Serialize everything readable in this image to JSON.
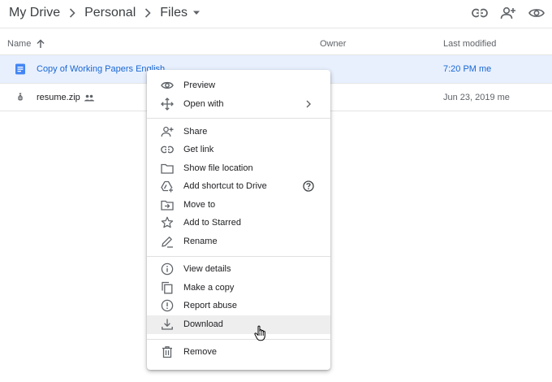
{
  "breadcrumb": {
    "items": [
      "My Drive",
      "Personal",
      "Files"
    ]
  },
  "header_icons": [
    "link-icon",
    "add-person-icon",
    "eye-icon"
  ],
  "columns": {
    "name": "Name",
    "owner": "Owner",
    "modified": "Last modified"
  },
  "files": [
    {
      "name": "Copy of Working Papers English",
      "owner": "",
      "modified": "7:20 PM",
      "by": "me",
      "icon": "google-doc-icon",
      "selected": true
    },
    {
      "name": "resume.zip",
      "owner": "",
      "modified": "Jun 23, 2019",
      "by": "me",
      "icon": "zip-file-icon",
      "shared": true
    }
  ],
  "context_menu": {
    "items": [
      {
        "label": "Preview",
        "icon": "eye-icon"
      },
      {
        "label": "Open with",
        "icon": "move-arrows-icon",
        "submenu": true
      },
      {
        "label": "Share",
        "icon": "add-person-icon"
      },
      {
        "label": "Get link",
        "icon": "link-icon"
      },
      {
        "label": "Show file location",
        "icon": "folder-icon"
      },
      {
        "label": "Add shortcut to Drive",
        "icon": "drive-shortcut-icon",
        "help": true
      },
      {
        "label": "Move to",
        "icon": "move-to-folder-icon"
      },
      {
        "label": "Add to Starred",
        "icon": "star-icon"
      },
      {
        "label": "Rename",
        "icon": "pencil-icon"
      },
      {
        "label": "View details",
        "icon": "info-icon"
      },
      {
        "label": "Make a copy",
        "icon": "copy-icon"
      },
      {
        "label": "Report abuse",
        "icon": "report-icon"
      },
      {
        "label": "Download",
        "icon": "download-icon",
        "hovered": true
      },
      {
        "label": "Remove",
        "icon": "trash-icon"
      }
    ]
  },
  "colors": {
    "selected_row_bg": "#e8f0fe",
    "selected_text": "#1967d2",
    "doc_icon": "#4285f4",
    "menu_hover_bg": "#eeeeee"
  }
}
